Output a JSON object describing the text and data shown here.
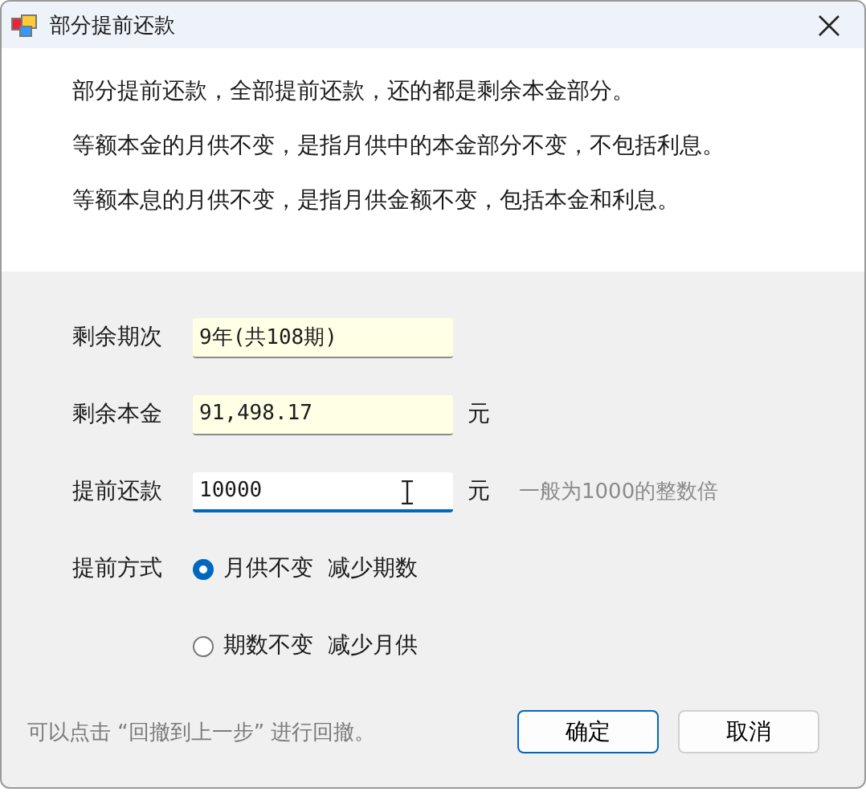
{
  "window": {
    "title": "部分提前还款"
  },
  "notes": [
    "部分提前还款，全部提前还款，还的都是剩余本金部分。",
    "等额本金的月供不变，是指月供中的本金部分不变，不包括利息。",
    "等额本息的月供不变，是指月供金额不变，包括本金和利息。"
  ],
  "fields": [
    {
      "label": "剩余期次",
      "value": "9年(共108期)",
      "readonly": true,
      "focused": false
    },
    {
      "label": "剩余本金",
      "value": "91,498.17",
      "unit": "元",
      "readonly": true,
      "focused": false
    },
    {
      "label": "提前还款",
      "value": "10000",
      "unit": "元",
      "hint": "一般为1000的整数倍",
      "readonly": false,
      "focused": true
    }
  ],
  "method": {
    "label": "提前方式",
    "options": [
      {
        "label": "月供不变  减少期数",
        "selected": true
      },
      {
        "label": "期数不变  减少月供",
        "selected": false
      }
    ]
  },
  "footer_hint": "可以点击 “回撤到上一步” 进行回撤。",
  "buttons": [
    {
      "label": "确定",
      "default": true
    },
    {
      "label": "取消",
      "default": false
    }
  ]
}
